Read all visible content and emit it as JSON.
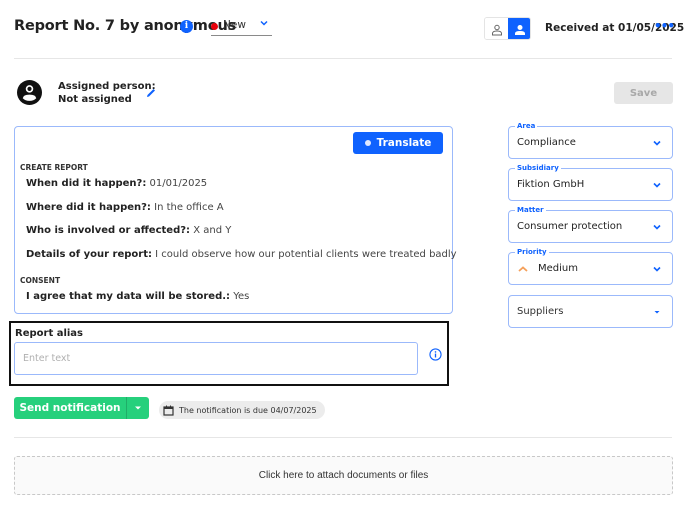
{
  "header": {
    "title": "Report No. 7 by anonymous",
    "info_icon": "info-icon",
    "status": {
      "label": "New",
      "color": "#e8000b"
    },
    "view_toggle": {
      "options": [
        "person-outline-icon",
        "person-filled-icon"
      ],
      "active": 1
    },
    "received": "Received at 01/05/2025",
    "more_icon": "more-horizontal-icon"
  },
  "assigned": {
    "label": "Assigned person:",
    "value": "Not assigned",
    "edit_icon": "pencil-icon"
  },
  "toolbar": {
    "save_label": "Save"
  },
  "report": {
    "translate_label": "Translate",
    "sections": [
      {
        "title": "CREATE REPORT",
        "items": [
          {
            "q": "When did it happen?:",
            "a": "01/01/2025"
          },
          {
            "q": "Where did it happen?:",
            "a": "In the office A"
          },
          {
            "q": "Who is involved or affected?:",
            "a": "X and Y"
          },
          {
            "q": "Details of your report:",
            "a": "I could observe how our potential clients were treated badly"
          }
        ]
      },
      {
        "title": "CONSENT",
        "items": [
          {
            "q": "I agree that my data will be stored.:",
            "a": "Yes"
          }
        ]
      }
    ]
  },
  "alias": {
    "label": "Report alias",
    "value": "",
    "placeholder": "Enter text"
  },
  "notification": {
    "send_label": "Send notification",
    "due_text": "The notification is due 04/07/2025"
  },
  "attach": {
    "label": "Click here to attach documents or files"
  },
  "fields": {
    "area": {
      "legend": "Area",
      "value": "Compliance"
    },
    "subsidiary": {
      "legend": "Subsidiary",
      "value": "Fiktion GmbH"
    },
    "matter": {
      "legend": "Matter",
      "value": "Consumer protection"
    },
    "priority": {
      "legend": "Priority",
      "value": "Medium",
      "color": "#f5a05a"
    },
    "category": {
      "value": "Suppliers"
    }
  },
  "colors": {
    "accent": "#0f62fe",
    "success": "#26d07c",
    "border": "#9bb9fb"
  }
}
